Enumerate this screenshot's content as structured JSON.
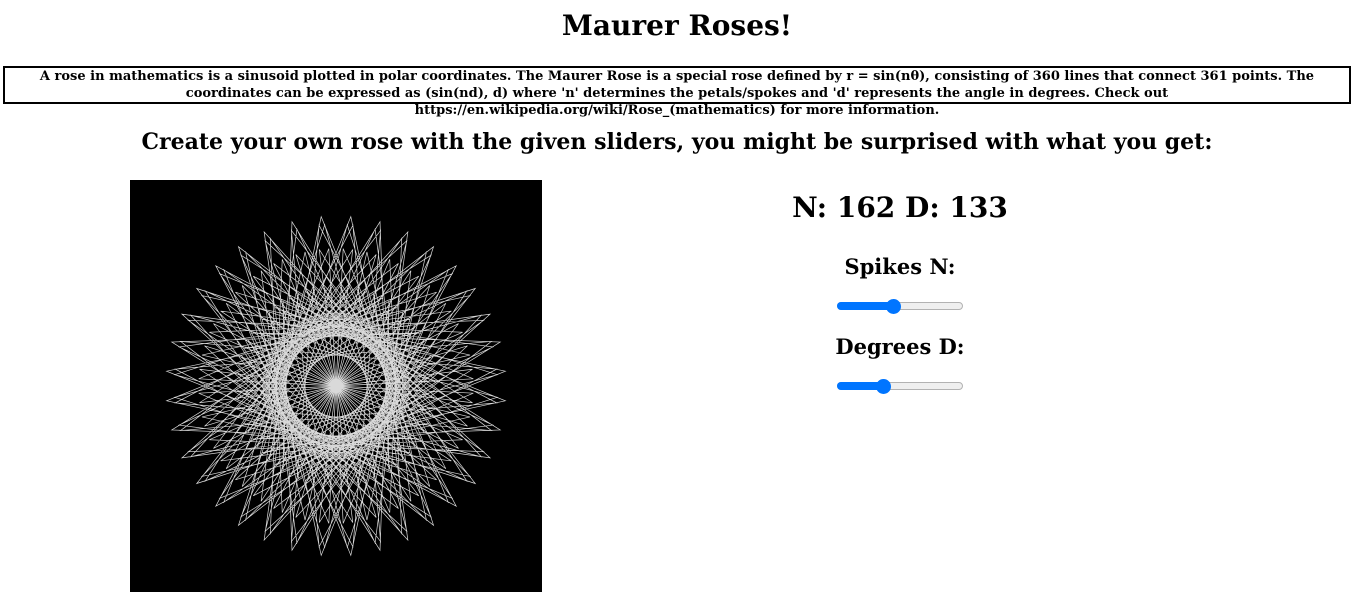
{
  "header": {
    "title": "Maurer Roses!",
    "description": "A rose in mathematics is a sinusoid plotted in polar coordinates. The Maurer Rose is a special rose defined by r = sin(nθ), consisting of 360 lines that connect 361 points. The coordinates can be expressed as (sin(nd), d) where 'n' determines the petals/spokes and 'd' represents the angle in degrees. Check out https://en.wikipedia.org/wiki/Rose_(mathematics) for more information.",
    "subtitle": "Create your own rose with the given sliders, you might be surprised with what you get:"
  },
  "rose": {
    "n": 162,
    "d": 133,
    "line_color": "#ffffff",
    "background_color": "#000000"
  },
  "controls": {
    "readout": "N: 162 D: 133",
    "spikes_label": "Spikes N:",
    "degrees_label": "Degrees D:",
    "spikes_slider": {
      "value": 162,
      "min": 0,
      "max": 360
    },
    "degrees_slider": {
      "value": 133,
      "min": 0,
      "max": 360
    },
    "accent_color": "#0075ff"
  }
}
